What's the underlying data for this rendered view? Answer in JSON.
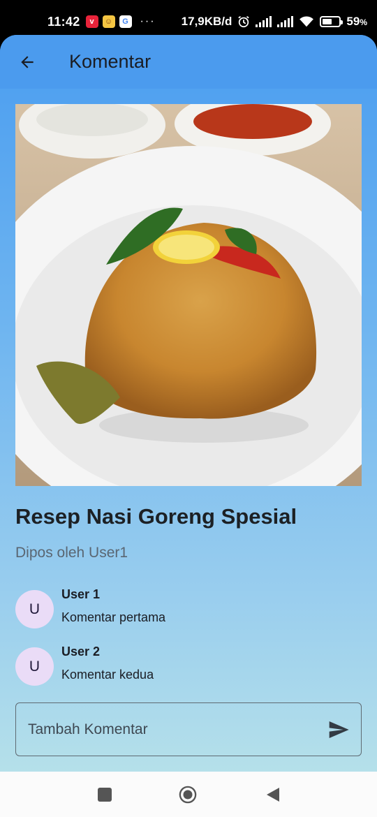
{
  "status_bar": {
    "time": "11:42",
    "network_speed": "17,9KB/d",
    "battery": "59",
    "battery_suffix": "%",
    "more": "···",
    "icons": [
      "alarm-icon",
      "signal-icon",
      "signal-icon",
      "wifi-icon",
      "battery-icon"
    ],
    "battery_level": 0.59
  },
  "app_bar": {
    "title": "Komentar",
    "back_icon": "arrow-left-icon"
  },
  "post": {
    "image_description_icon": "food-photo",
    "title": "Resep Nasi Goreng Spesial",
    "author": "Dipos oleh User1"
  },
  "comments": [
    {
      "avatar": "U",
      "user": "User 1",
      "text": "Komentar pertama"
    },
    {
      "avatar": "U",
      "user": "User 2",
      "text": "Komentar kedua"
    }
  ],
  "comment_input": {
    "placeholder": "Tambah Komentar",
    "value": "",
    "send_icon": "send-icon"
  },
  "nav": {
    "icons": [
      "recent-apps-icon",
      "home-icon",
      "back-icon"
    ]
  },
  "colors": {
    "app_bar": "#4b9bee",
    "avatar_bg": "#eadcf7",
    "gradient_top": "#4a9df0",
    "gradient_bottom": "#b5e0ea"
  }
}
